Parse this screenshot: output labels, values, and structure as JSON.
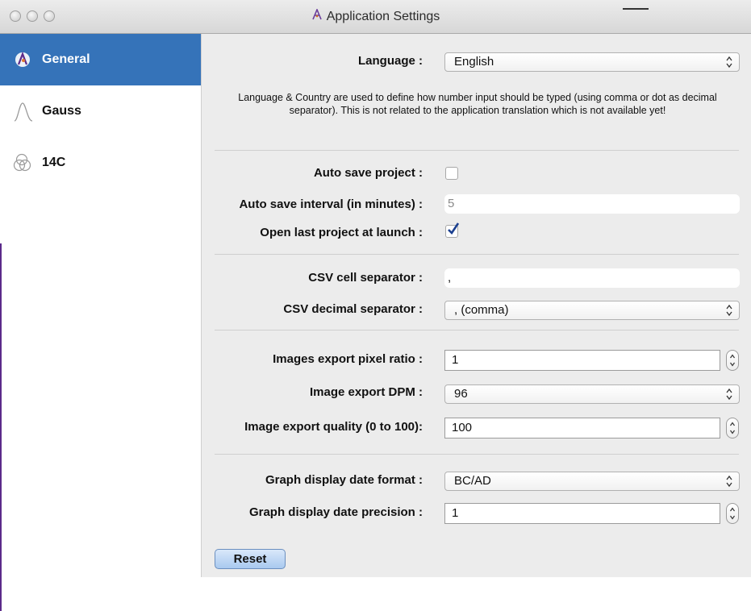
{
  "window": {
    "title": "Application Settings"
  },
  "sidebar": {
    "items": [
      {
        "label": "General",
        "icon": "chronomodel-icon",
        "active": true
      },
      {
        "label": "Gauss",
        "icon": "gauss-curve-icon",
        "active": false
      },
      {
        "label": "14C",
        "icon": "14c-circles-icon",
        "active": false
      }
    ]
  },
  "general": {
    "language": {
      "label": "Language :",
      "value": "English"
    },
    "info_text": "Language & Country are used to define how number input should be typed (using comma or dot as decimal separator). This is not related to the application translation which is not available yet!",
    "auto_save": {
      "label": "Auto save project :",
      "checked": false
    },
    "auto_save_interval": {
      "label": "Auto save interval (in minutes) :",
      "value": "5"
    },
    "open_last": {
      "label": "Open last project at launch :",
      "checked": true
    },
    "csv_cell": {
      "label": "CSV cell separator :",
      "value": ","
    },
    "csv_decimal": {
      "label": "CSV decimal separator :",
      "value": ", (comma)"
    },
    "pixel_ratio": {
      "label": "Images export pixel ratio :",
      "value": "1"
    },
    "dpm": {
      "label": "Image export DPM :",
      "value": "96"
    },
    "quality": {
      "label": "Image export quality (0 to 100):",
      "value": "100"
    },
    "date_format": {
      "label": "Graph display date format :",
      "value": "BC/AD"
    },
    "date_precision": {
      "label": "Graph display date precision :",
      "value": "1"
    },
    "reset_label": "Reset"
  }
}
